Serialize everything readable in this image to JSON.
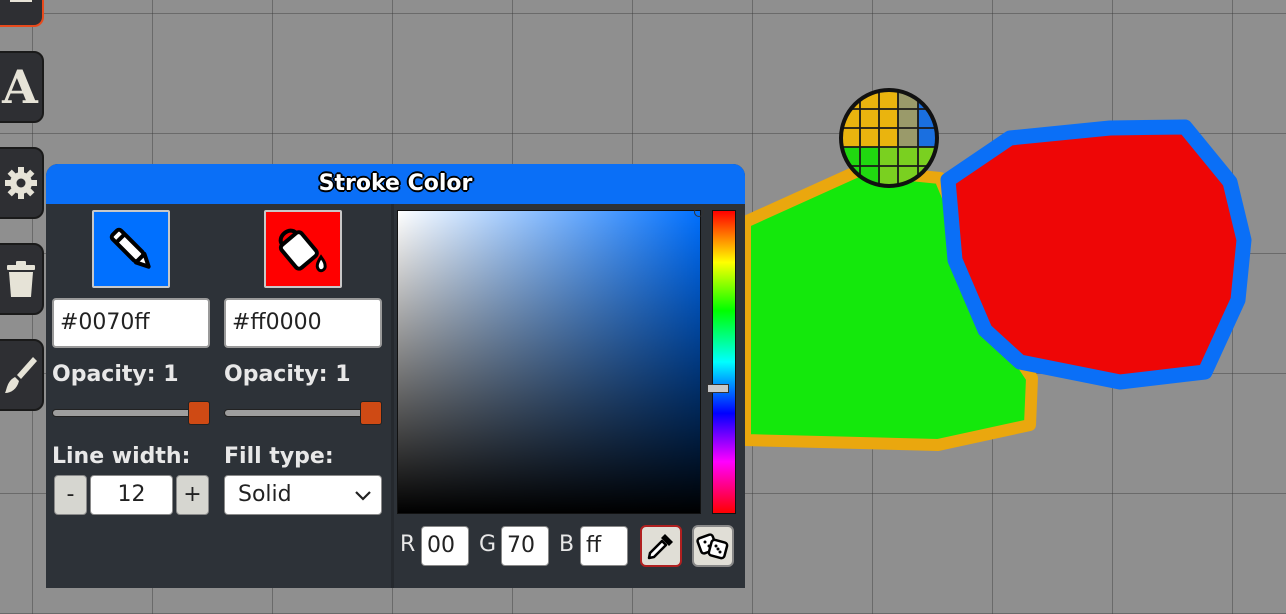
{
  "panel": {
    "title": "Stroke Color",
    "stroke": {
      "color": "#0070ff",
      "hex_value": "#0070ff",
      "opacity_label": "Opacity: 1",
      "opacity": 1
    },
    "fill": {
      "color": "#ff0000",
      "hex_value": "#ff0000",
      "opacity_label": "Opacity: 1",
      "opacity": 1
    },
    "line_width": {
      "label": "Line width:",
      "value": "12",
      "decrement": "-",
      "increment": "+"
    },
    "fill_type": {
      "label": "Fill type:",
      "value": "Solid"
    },
    "picker": {
      "r_label": "R",
      "g_label": "G",
      "b_label": "B",
      "r": "00",
      "g": "70",
      "b": "ff",
      "hue_position": 0.59
    }
  },
  "toolbar": {
    "items": [
      {
        "name": "draw-tool",
        "icon": "pen-icon"
      },
      {
        "name": "text-tool",
        "icon": "text-icon",
        "letter": "A"
      },
      {
        "name": "settings",
        "icon": "gear-icon"
      },
      {
        "name": "delete",
        "icon": "trash-icon"
      },
      {
        "name": "brush",
        "icon": "brush-icon"
      }
    ]
  },
  "colors": {
    "accent": "#0a6ff7",
    "panel_bg": "#2d3238",
    "canvas_bg": "#8f8f8f",
    "shape_green": "#14e80c",
    "shape_orange": "#eaa70e",
    "shape_red": "#ee0606",
    "shape_blue": "#0a6ff7",
    "slider_thumb": "#cf4a14"
  }
}
